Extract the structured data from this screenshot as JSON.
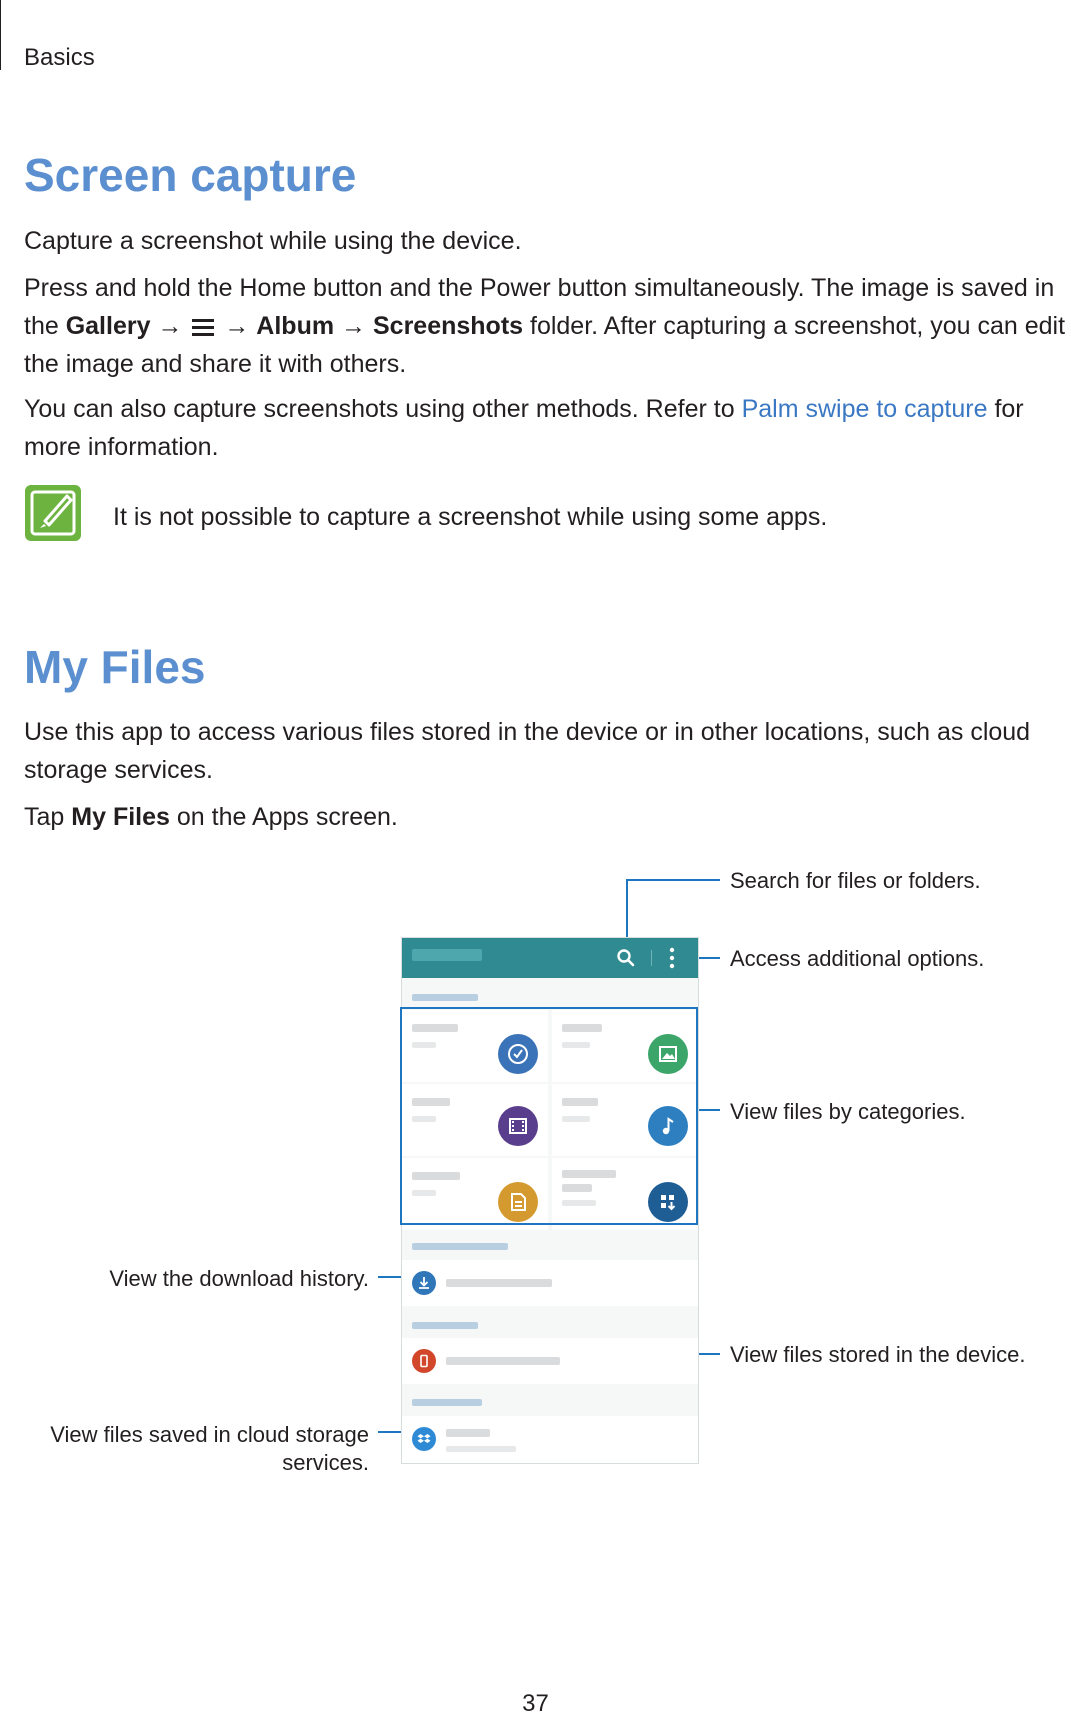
{
  "header": {
    "section": "Basics"
  },
  "screen_capture": {
    "title": "Screen capture",
    "intro": "Capture a screenshot while using the device.",
    "para1_a": "Press and hold the Home button and the Power button simultaneously. The image is saved in",
    "para1_b_pre": "the ",
    "gallery": "Gallery",
    "arrow": "→",
    "album": "Album",
    "screenshots": "Screenshots",
    "para1_b_post": " folder. After capturing a screenshot, you can edit",
    "para1_c": "the image and share it with others.",
    "para2_a_pre": "You can also capture screenshots using other methods. Refer to ",
    "para2_link": "Palm swipe to capture",
    "para2_a_post": " for",
    "para2_b": "more information.",
    "note": "It is not possible to capture a screenshot while using some apps."
  },
  "my_files": {
    "title": "My Files",
    "para1_a": "Use this app to access various files stored in the device or in other locations, such as cloud",
    "para1_b": "storage services.",
    "tap_pre": "Tap ",
    "tap_bold": "My Files",
    "tap_post": " on the Apps screen."
  },
  "callouts": {
    "search": "Search for files or folders.",
    "options": "Access additional options.",
    "categories": "View files by categories.",
    "download": "View the download history.",
    "device": "View files stored in the device.",
    "cloud_a": "View files saved in cloud storage",
    "cloud_b": "services."
  },
  "icons": {
    "note": "note-pencil-icon",
    "menu": "menu-icon",
    "search": "search-icon",
    "more": "more-options-icon",
    "recent": "clock-icon",
    "images": "image-icon",
    "videos": "video-icon",
    "audio": "music-note-icon",
    "documents": "document-icon",
    "downloaded": "download-apps-icon",
    "download_history": "download-icon",
    "device_storage": "device-icon",
    "dropbox": "dropbox-icon"
  },
  "colors": {
    "heading": "#5b8fcf",
    "link": "#3a78c3",
    "callout": "#1f76c0",
    "note_icon": "#6cb33f",
    "appbar": "#2f8a92",
    "recent": "#3a73b7",
    "images": "#3ba56a",
    "videos": "#5a3e8e",
    "audio": "#2e7fc0",
    "documents": "#d59a2f",
    "downloaded": "#1f5d95",
    "download_row": "#2f77b8",
    "device_row": "#d2472a",
    "dropbox_row": "#2f8ad6"
  },
  "page": {
    "number": "37"
  }
}
